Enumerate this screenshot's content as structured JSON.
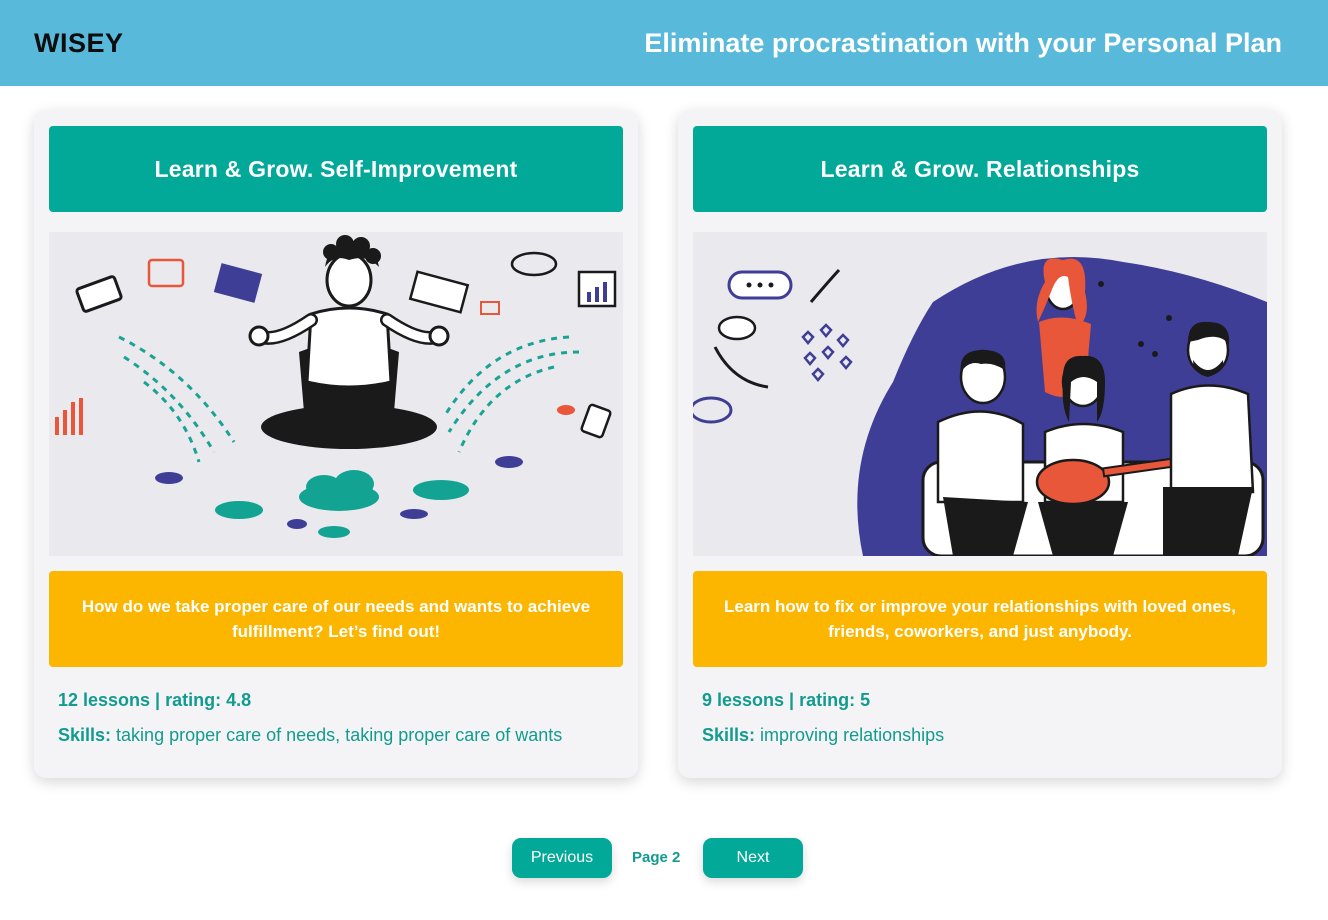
{
  "header": {
    "logo": "WISEY",
    "tagline": "Eliminate procrastination with your Personal Plan"
  },
  "cards": [
    {
      "title": "Learn & Grow. Self-Improvement",
      "description": "How do we take proper care of our needs and wants to achieve fulfillment? Let’s find out!",
      "stats": "12 lessons | rating: 4.8",
      "skills_label": "Skills:",
      "skills": "taking proper care of needs, taking proper care of wants",
      "illustration": "meditating-person-illustration"
    },
    {
      "title": "Learn & Grow. Relationships",
      "description": "Learn how to fix or improve your relationships with loved ones, friends, coworkers, and just anybody.",
      "stats": "9 lessons | rating: 5",
      "skills_label": "Skills:",
      "skills": "improving relationships",
      "illustration": "friends-on-sofa-illustration"
    }
  ],
  "pagination": {
    "previous_label": "Previous",
    "page_label": "Page 2",
    "next_label": "Next"
  },
  "colors": {
    "header": "#58b9db",
    "teal": "#02a898",
    "amber": "#fdb600",
    "text_teal": "#129b8e",
    "indigo": "#3f3e96",
    "orange": "#e8573a"
  }
}
